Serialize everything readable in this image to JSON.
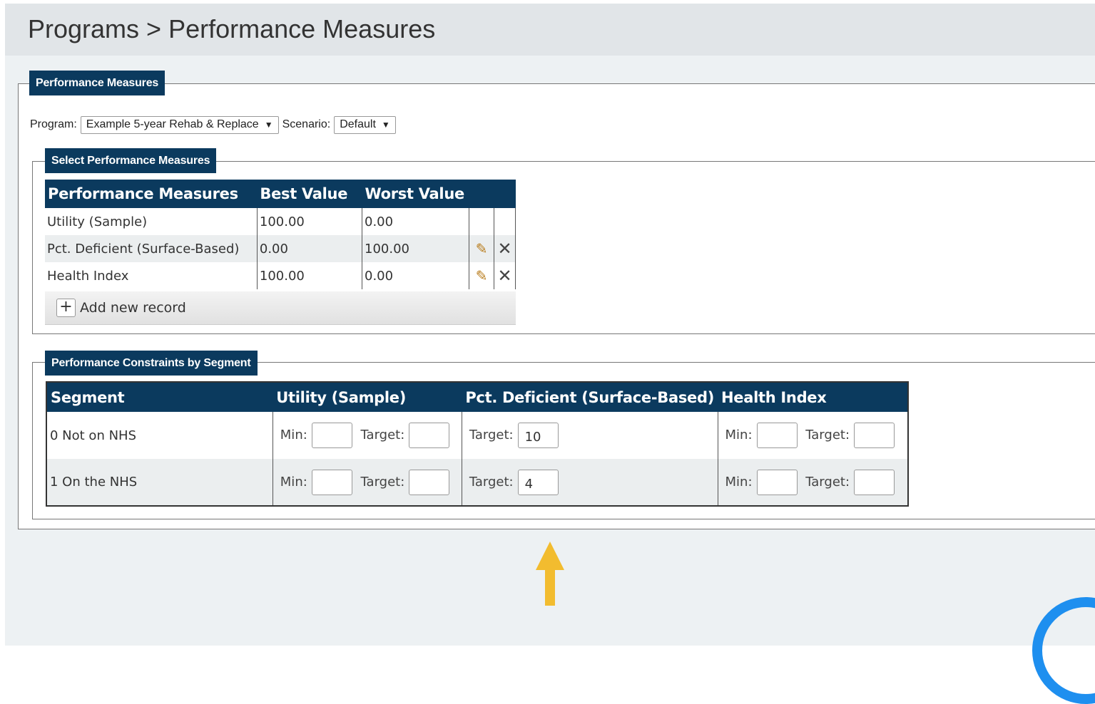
{
  "header": {
    "breadcrumb": "Programs > Performance Measures"
  },
  "performance_measures": {
    "legend": "Performance Measures",
    "program_label": "Program:",
    "program_value": "Example 5-year Rehab & Replace",
    "scenario_label": "Scenario:",
    "scenario_value": "Default"
  },
  "select_measures": {
    "legend": "Select Performance Measures",
    "columns": [
      "Performance Measures",
      "Best Value",
      "Worst Value"
    ],
    "rows": [
      {
        "name": "Utility (Sample)",
        "best": "100.00",
        "worst": "0.00"
      },
      {
        "name": "Pct. Deficient (Surface-Based)",
        "best": "0.00",
        "worst": "100.00"
      },
      {
        "name": "Health Index",
        "best": "100.00",
        "worst": "0.00"
      }
    ],
    "add_label": "Add new record"
  },
  "constraints": {
    "legend": "Performance Constraints by Segment",
    "columns": [
      "Segment",
      "Utility (Sample)",
      "Pct. Deficient (Surface-Based)",
      "Health Index"
    ],
    "min_label": "Min:",
    "target_label": "Target:",
    "rows": [
      {
        "segment": "0 Not on NHS",
        "pct_target": "10"
      },
      {
        "segment": "1 On the NHS",
        "pct_target": "4"
      }
    ]
  },
  "colors": {
    "header_navy": "#0b3a5e",
    "arrow_yellow": "#f2bc2f",
    "accent_blue": "#1e8fef"
  },
  "icons": [
    "pencil-icon",
    "delete-icon",
    "plus-icon",
    "dropdown-arrow-icon",
    "up-arrow-icon"
  ]
}
